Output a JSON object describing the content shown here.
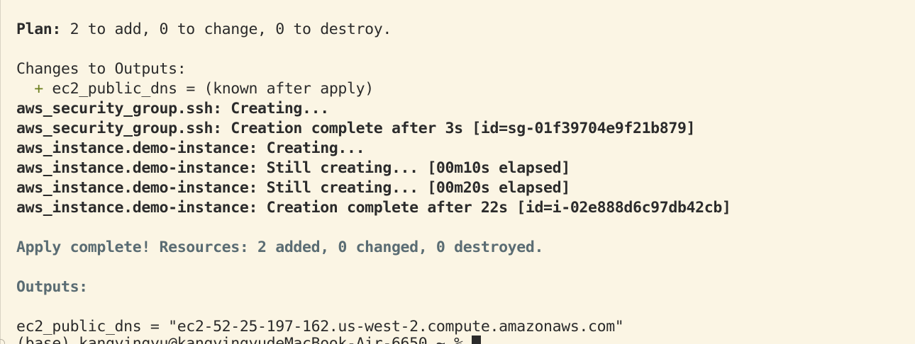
{
  "terminal": {
    "plan_label": "Plan:",
    "plan_text": " 2 to add, 0 to change, 0 to destroy.",
    "changes_header": "Changes to Outputs:",
    "change_marker": "+",
    "change_line": " ec2_public_dns = (known after apply)",
    "log_lines": [
      "aws_security_group.ssh: Creating...",
      "aws_security_group.ssh: Creation complete after 3s [id=sg-01f39704e9f21b879]",
      "aws_instance.demo-instance: Creating...",
      "aws_instance.demo-instance: Still creating... [00m10s elapsed]",
      "aws_instance.demo-instance: Still creating... [00m20s elapsed]",
      "aws_instance.demo-instance: Creation complete after 22s [id=i-02e888d6c97db42cb]"
    ],
    "apply_complete": "Apply complete! Resources: 2 added, 0 changed, 0 destroyed.",
    "outputs_header": "Outputs:",
    "output_line": "ec2_public_dns = \"ec2-52-25-197-162.us-west-2.compute.amazonaws.com\"",
    "prompt": "(base) kangyingyu@kangyingyudeMacBook-Air-6650 ~ % "
  },
  "colors": {
    "background": "#fbf5e4",
    "text": "#2b2b2b",
    "added_marker": "#6b7f1e",
    "apply_status": "#5a6c73"
  }
}
